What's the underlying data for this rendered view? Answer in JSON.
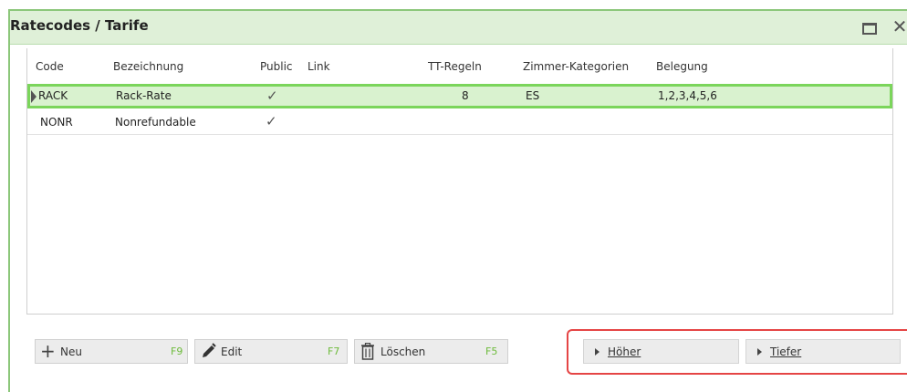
{
  "window": {
    "title": "Ratecodes / Tarife"
  },
  "table": {
    "columns": [
      "Code",
      "Bezeichnung",
      "Public",
      "Link",
      "TT-Regeln",
      "Zimmer-Kategorien",
      "Belegung"
    ],
    "rows": [
      {
        "code": "RACK",
        "bezeichnung": "Rack-Rate",
        "public": "✓",
        "link": "",
        "tt_regeln": "8",
        "zimmer": "ES",
        "belegung": "1,2,3,4,5,6",
        "selected": true
      },
      {
        "code": "NONR",
        "bezeichnung": "Nonrefundable",
        "public": "✓",
        "link": "",
        "tt_regeln": "",
        "zimmer": "",
        "belegung": "",
        "selected": false
      }
    ]
  },
  "buttons": {
    "neu": {
      "label": "Neu",
      "key": "F9",
      "icon": "plus-icon"
    },
    "edit": {
      "label": "Edit",
      "key": "F7",
      "icon": "pencil-icon"
    },
    "loeschen": {
      "label": "Löschen",
      "key": "F5",
      "icon": "trash-icon"
    },
    "hoeher": {
      "label": "Höher",
      "icon": "triangle-right-icon"
    },
    "tiefer": {
      "label": "Tiefer",
      "icon": "triangle-right-icon"
    }
  },
  "colors": {
    "title_bg": "#dff0d8",
    "selected_bg": "#d9f2cf",
    "selected_border": "#7bd55b",
    "shortcut_key": "#6dbb3b",
    "highlight_frame": "#e54545"
  }
}
